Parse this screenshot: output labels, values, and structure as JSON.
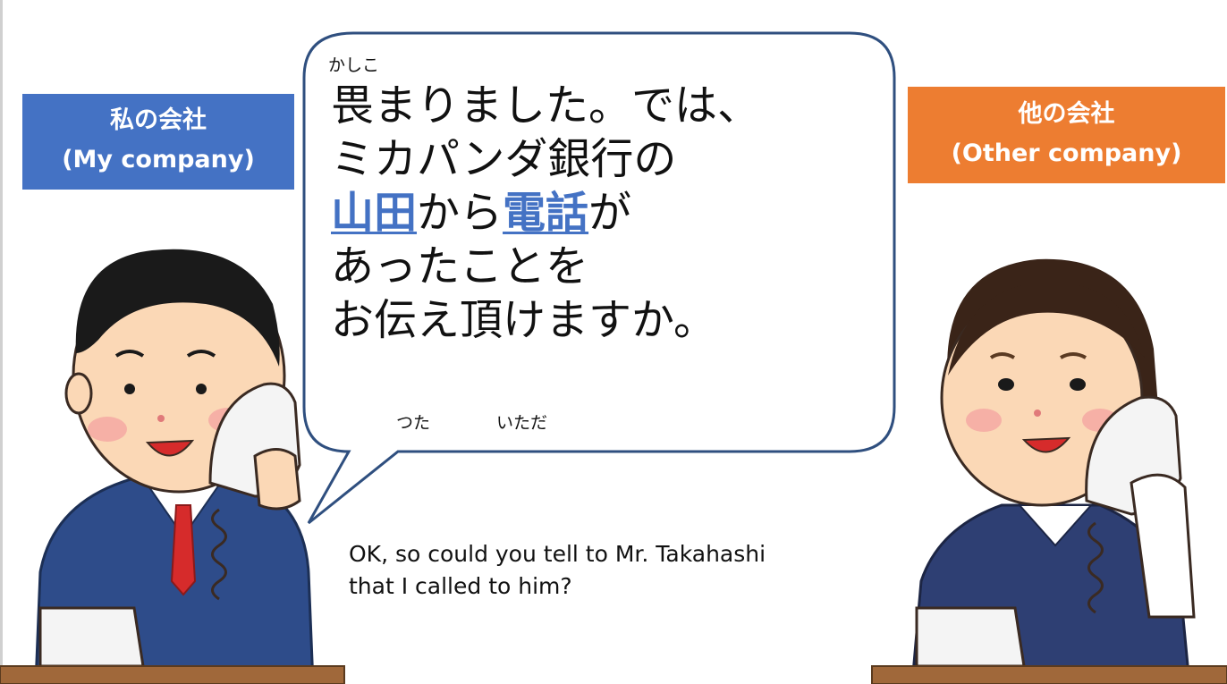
{
  "labels": {
    "my_company_jp": "私の会社",
    "my_company_en": "(My company)",
    "other_company_jp": "他の会社",
    "other_company_en": "(Other company)"
  },
  "speech": {
    "furigana_kashiko": "かしこ",
    "line1": "畏まりました。では、",
    "line2": "ミカパンダ銀行の",
    "line3_hl1": "山田",
    "line3_mid": "から",
    "line3_hl2": "電話",
    "line3_end": "が",
    "line4": "あったことを",
    "line5": "お伝え頂けますか。",
    "furigana_tsuta": "つた",
    "furigana_itada": "いただ"
  },
  "translation": {
    "line1": "OK, so could you tell to Mr. Takahashi",
    "line2": "that I called to him?"
  },
  "colors": {
    "my_label_bg": "#4472c4",
    "other_label_bg": "#ed7d31",
    "highlight": "#4472c4",
    "bubble_border": "#2f4f7f"
  },
  "icons": {
    "left_character": "businessman-on-phone",
    "right_character": "businesswoman-on-phone"
  }
}
